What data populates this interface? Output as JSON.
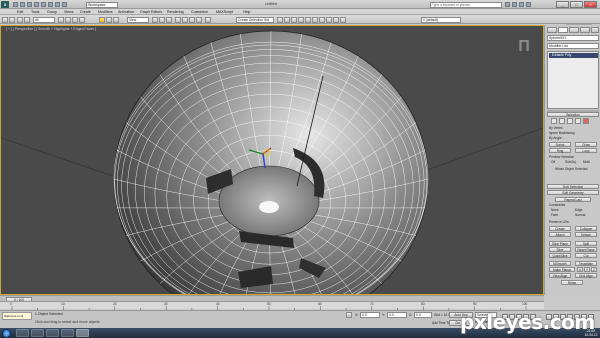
{
  "app": {
    "logo_text": "3",
    "workspace": "Workspace",
    "title": "Untitled",
    "search_placeholder": "Type a keyword or phrase",
    "message_button": "Message"
  },
  "menu": [
    "Edit",
    "Tools",
    "Group",
    "Views",
    "Create",
    "Modifiers",
    "Animation",
    "Graph Editors",
    "Rendering",
    "Customize",
    "MAXScript",
    "Help"
  ],
  "toolbar": {
    "selection_filter": "All",
    "ref_coord": "View",
    "named_selection": "Create Selection Set",
    "layer": "0 (default)"
  },
  "viewport": {
    "label": "[ + ] [ Perspective ] [ Smooth + Highlights + Edged Faces ]",
    "viewcube_glyph": "Π"
  },
  "command_panel": {
    "object_name": "Sphere001",
    "modifier_list": "Modifier List",
    "stack_item": "Editable Poly",
    "selection_rollout": "Selection",
    "by_vertex": "By Vertex",
    "ignore_backfacing": "Ignore Backfacing",
    "by_angle": "By Angle:",
    "shrink": "Shrink",
    "grow": "Grow",
    "ring": "Ring",
    "loop": "Loop",
    "preview_selection": "Preview Selection",
    "off": "Off",
    "subobj": "SubObj",
    "multi": "Multi",
    "whole_selected": "Whole Object Selected",
    "soft_selection": "Soft Selection",
    "edit_geometry": "Edit Geometry",
    "repeat_last": "Repeat Last",
    "constraints": "Constraints",
    "none": "None",
    "edge": "Edge",
    "face": "Face",
    "normal": "Normal",
    "preserve_uvs": "Preserve UVs",
    "create": "Create",
    "collapse": "Collapse",
    "attach": "Attach",
    "detach": "Detach",
    "slice_plane": "Slice Plane",
    "split": "Split",
    "slice": "Slice",
    "reset_plane": "Reset Plane",
    "quickslice": "QuickSlice",
    "cut": "Cut",
    "msmooth": "MSmooth",
    "tessellate": "Tessellate",
    "make_planar": "Make Planar",
    "x": "X",
    "y": "Y",
    "z": "Z",
    "view_align": "View Align",
    "grid_align": "Grid Align",
    "relax": "Relax"
  },
  "timeline": {
    "slider_label": "0 / 100",
    "ticks": [
      "0",
      "10",
      "20",
      "30",
      "40",
      "50",
      "60",
      "70",
      "80",
      "90",
      "100"
    ]
  },
  "status": {
    "objects_selected": "1 Object Selected",
    "prompt": "Click and drag to select and move objects",
    "x_label": "X:",
    "x_value": "0.0",
    "y_label": "Y:",
    "y_value": "0.0",
    "z_label": "Z:",
    "z_value": "0.0",
    "grid": "Grid = 10.0",
    "auto_key": "Auto Key",
    "selected": "Selected",
    "set_key": "Set Key",
    "key_filters": "Key Filters...",
    "add_time_tag": "Add Time Tag",
    "maxscript_label": "Welcome to M"
  },
  "taskbar": {
    "time": "21:55",
    "date": "10-04-12"
  },
  "watermark": "pxleyes.com",
  "colors": {
    "viewport_bg": "#4a4a4a",
    "active_border": "#c9a838",
    "wire": "#ffffff",
    "accent": "#37466e"
  }
}
